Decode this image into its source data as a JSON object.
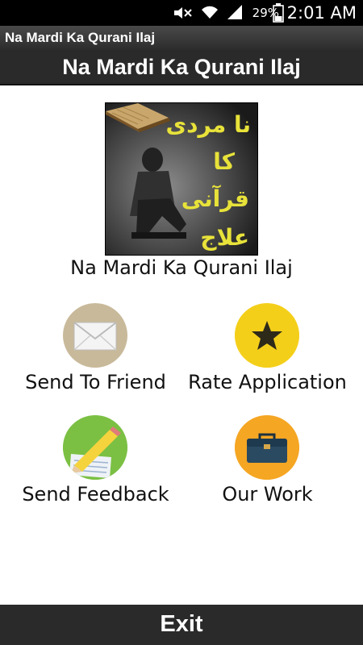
{
  "status_bar": {
    "battery_percent": "29%",
    "time": "2:01 AM",
    "icons": [
      "mute-icon",
      "wifi-icon",
      "signal-icon",
      "battery-icon"
    ]
  },
  "app_bar": {
    "title": "Na Mardi Ka Qurani Ilaj"
  },
  "header": {
    "heading": "Na Mardi Ka Qurani Ilaj"
  },
  "cover": {
    "urdu_lines": [
      "نا مردی",
      "کا",
      "قرآنی",
      "علاج"
    ],
    "urdu_color": "#e8e23a"
  },
  "app_name": "Na Mardi Ka Qurani Ilaj",
  "menu": [
    {
      "label": "Send To Friend",
      "icon": "mail-icon",
      "color": "#c8b99a"
    },
    {
      "label": "Rate Application",
      "icon": "star-icon",
      "color": "#f4cf1a"
    },
    {
      "label": "Send Feedback",
      "icon": "pencil-notepad-icon",
      "color": "#7bc043"
    },
    {
      "label": "Our Work",
      "icon": "briefcase-icon",
      "color": "#f5a623"
    }
  ],
  "exit": {
    "label": "Exit"
  }
}
